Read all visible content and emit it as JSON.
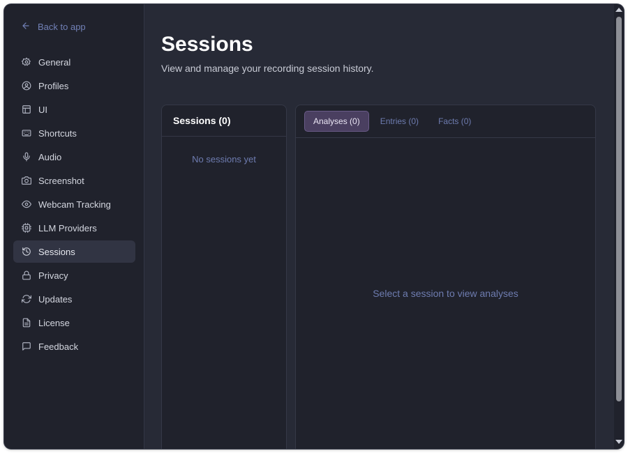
{
  "sidebar": {
    "back_label": "Back to app",
    "items": [
      {
        "label": "General",
        "icon": "gear-icon"
      },
      {
        "label": "Profiles",
        "icon": "user-circle-icon"
      },
      {
        "label": "UI",
        "icon": "layout-icon"
      },
      {
        "label": "Shortcuts",
        "icon": "keyboard-icon"
      },
      {
        "label": "Audio",
        "icon": "microphone-icon"
      },
      {
        "label": "Screenshot",
        "icon": "camera-icon"
      },
      {
        "label": "Webcam Tracking",
        "icon": "eye-icon"
      },
      {
        "label": "LLM Providers",
        "icon": "cpu-icon"
      },
      {
        "label": "Sessions",
        "icon": "history-icon",
        "active": true
      },
      {
        "label": "Privacy",
        "icon": "lock-icon"
      },
      {
        "label": "Updates",
        "icon": "refresh-icon"
      },
      {
        "label": "License",
        "icon": "document-icon"
      },
      {
        "label": "Feedback",
        "icon": "message-icon"
      }
    ]
  },
  "main": {
    "title": "Sessions",
    "subtitle": "View and manage your recording session history.",
    "sessions_panel": {
      "header": "Sessions (0)",
      "empty_text": "No sessions yet"
    },
    "detail_panel": {
      "tabs": [
        {
          "label": "Analyses (0)",
          "active": true
        },
        {
          "label": "Entries (0)",
          "active": false
        },
        {
          "label": "Facts (0)",
          "active": false
        }
      ],
      "empty_text": "Select a session to view analyses"
    }
  },
  "colors": {
    "window_bg": "#272a36",
    "sidebar_bg": "#20222c",
    "accent_link": "#7180b6",
    "active_tab_bg": "#4a3f60"
  }
}
